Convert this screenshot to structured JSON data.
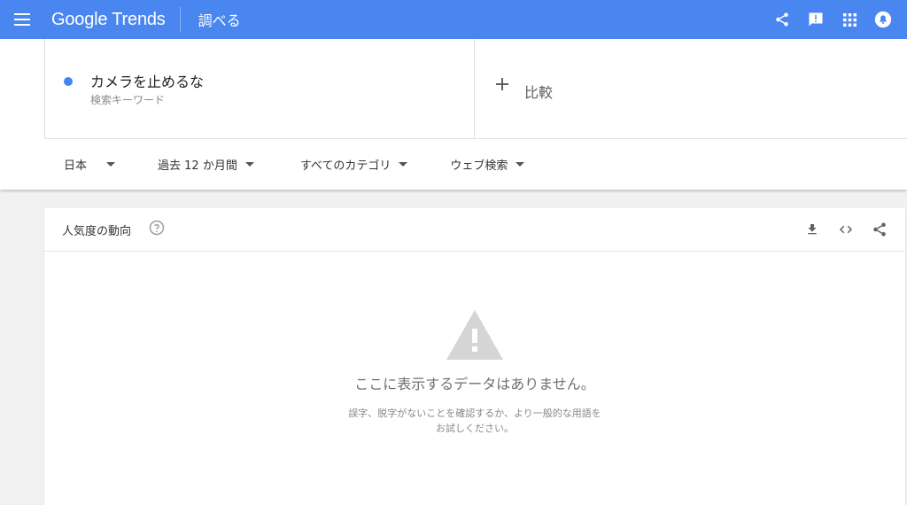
{
  "appbar": {
    "brand": "Google Trends",
    "title": "調べる",
    "color": "#4a86f0"
  },
  "terms": [
    {
      "label": "カメラを止めるな",
      "sublabel": "検索キーワード",
      "color": "#4285f4"
    }
  ],
  "compare": {
    "label": "比較"
  },
  "filters": [
    {
      "label": "日本"
    },
    {
      "label": "過去 12 か月間"
    },
    {
      "label": "すべてのカテゴリ"
    },
    {
      "label": "ウェブ検索"
    }
  ],
  "card": {
    "title": "人気度の動向",
    "empty_title": "ここに表示するデータはありません。",
    "empty_subtitle": "誤字、脱字がないことを確認するか、より一般的な用語をお試しください。"
  },
  "icons": {
    "appbar": [
      "menu-icon",
      "share-icon",
      "feedback-icon",
      "apps-grid-icon",
      "notifications-icon"
    ],
    "card": [
      "help-icon",
      "download-icon",
      "embed-code-icon",
      "share-icon",
      "warning-icon"
    ]
  }
}
